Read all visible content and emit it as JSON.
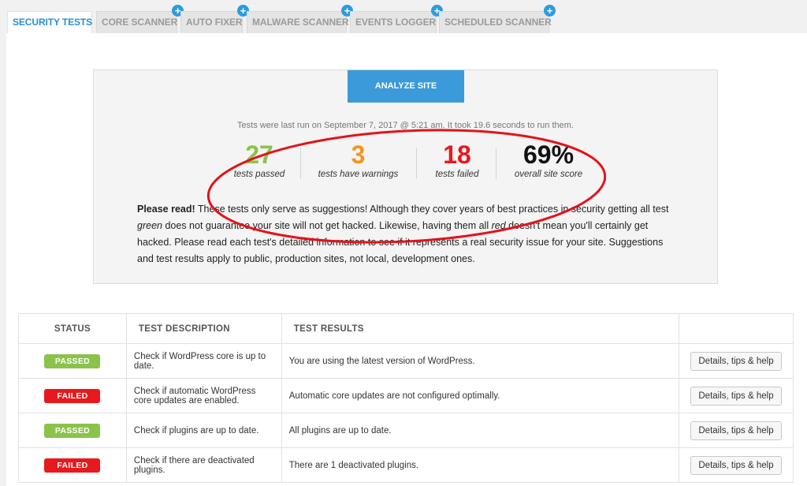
{
  "tabs": [
    {
      "label": "SECURITY TESTS",
      "active": true,
      "plus": false
    },
    {
      "label": "CORE SCANNER",
      "active": false,
      "plus": true
    },
    {
      "label": "AUTO FIXER",
      "active": false,
      "plus": true
    },
    {
      "label": "MALWARE SCANNER",
      "active": false,
      "plus": true
    },
    {
      "label": "EVENTS LOGGER",
      "active": false,
      "plus": true
    },
    {
      "label": "SCHEDULED SCANNER",
      "active": false,
      "plus": true
    }
  ],
  "plus_glyph": "+",
  "summary": {
    "analyze_label": "ANALYZE SITE",
    "last_run": "Tests were last run on September 7, 2017 @ 5:21 am. It took 19.6 seconds to run them.",
    "stats": [
      {
        "value": "27",
        "label": "tests passed",
        "color": "#8bc34a"
      },
      {
        "value": "3",
        "label": "tests have warnings",
        "color": "#f7941d"
      },
      {
        "value": "18",
        "label": "tests failed",
        "color": "#e8191d"
      },
      {
        "value": "69%",
        "label": "overall site score",
        "color": "#111111"
      }
    ],
    "notice": {
      "lead": "Please read!",
      "part1": " These tests only serve as suggestions! Although they cover years of best practices in security getting all test ",
      "green": "green",
      "part2": " does not guarantee your site will not get hacked. Likewise, having them all ",
      "red": "red",
      "part3": " doesn't mean you'll certainly get hacked. Please read each test's detailed information to see if it represents a real security issue for your site. Suggestions and test results apply to public, production sites, not local, development ones."
    },
    "annotation_color": "#e3131b"
  },
  "table": {
    "headers": [
      "STATUS",
      "TEST DESCRIPTION",
      "TEST RESULTS",
      ""
    ],
    "rows": [
      {
        "status": "PASSED",
        "description": "Check if WordPress core is up to date.",
        "result": "You are using the latest version of WordPress.",
        "action": "Details, tips & help"
      },
      {
        "status": "FAILED",
        "description": "Check if automatic WordPress core updates are enabled.",
        "result": "Automatic core updates are not configured optimally.",
        "action": "Details, tips & help"
      },
      {
        "status": "PASSED",
        "description": "Check if plugins are up to date.",
        "result": "All plugins are up to date.",
        "action": "Details, tips & help"
      },
      {
        "status": "FAILED",
        "description": "Check if there are deactivated plugins.",
        "result": "There are 1 deactivated plugins.",
        "action": "Details, tips & help"
      }
    ]
  },
  "colors": {
    "accent": "#2a8ecf",
    "button": "#3b9ad9",
    "passed": "#8bc34a",
    "failed": "#e8191d"
  }
}
